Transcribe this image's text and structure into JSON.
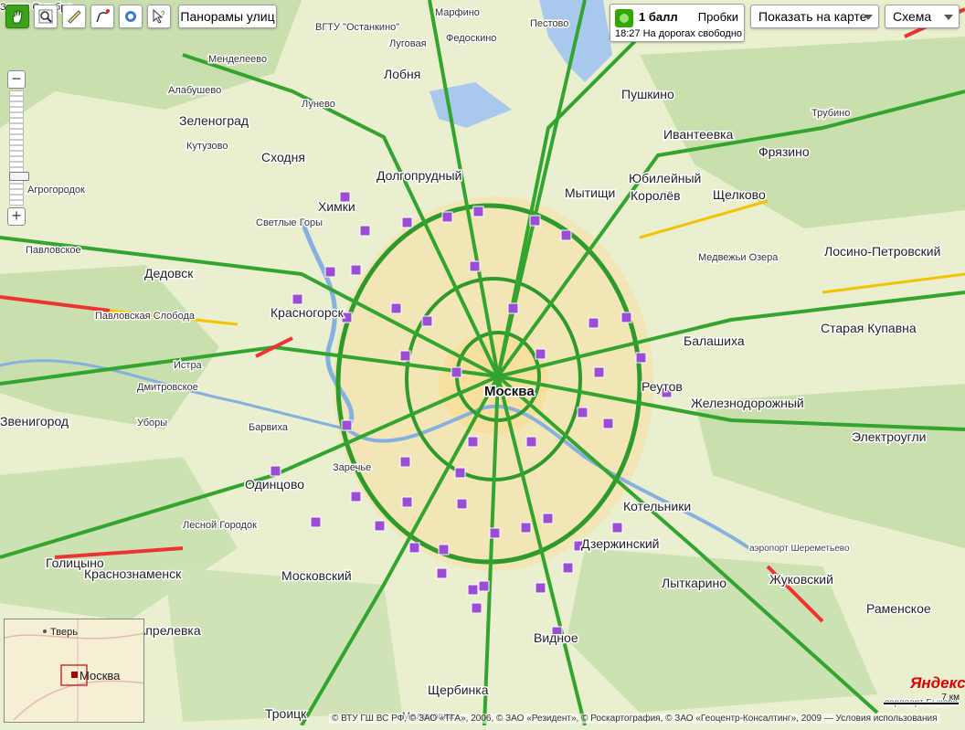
{
  "toolbar": {
    "tools": [
      {
        "name": "hand-tool",
        "icon": "hand-icon",
        "active": true
      },
      {
        "name": "magnifier-tool",
        "icon": "magnifier-icon",
        "active": false
      },
      {
        "name": "ruler-tool",
        "icon": "ruler-icon",
        "active": false
      },
      {
        "name": "route-tool",
        "icon": "route-icon",
        "active": false
      },
      {
        "name": "panorama-tool",
        "icon": "panorama-icon",
        "active": false
      },
      {
        "name": "info-tool",
        "icon": "info-cursor-icon",
        "active": false
      }
    ],
    "panorama_label": "Панорамы улиц"
  },
  "traffic": {
    "score": "1 балл",
    "label": "Пробки",
    "status": "18:27 На дорогах свободно",
    "light_color": "#2fa800"
  },
  "show_on_map": {
    "label": "Показать на карте"
  },
  "layer": {
    "label": "Схема"
  },
  "minimap": {
    "cities": [
      "Тверь",
      "Москва"
    ]
  },
  "brand": {
    "logo": "Яндекс"
  },
  "scale": {
    "label": "7 км"
  },
  "copyright": "© ВТУ ГШ ВС РФ, © ЗАО «ТГА», 2006, © ЗАО «Резидент», © Роскартография, © ЗАО «Геоцентр-Консалтинг», 2009 — Условия использования",
  "places": [
    {
      "name": "Марфино",
      "kind": "town"
    },
    {
      "name": "Пестово",
      "kind": "town"
    },
    {
      "name": "ВГТУ \"Останкино\"",
      "kind": "town"
    },
    {
      "name": "Федоскино",
      "kind": "town"
    },
    {
      "name": "Луговая",
      "kind": "town"
    },
    {
      "name": "Менделеево",
      "kind": "town"
    },
    {
      "name": "Лобня",
      "kind": "city"
    },
    {
      "name": "Алабушево",
      "kind": "town"
    },
    {
      "name": "Зеленоград",
      "kind": "city"
    },
    {
      "name": "Лунево",
      "kind": "town"
    },
    {
      "name": "Сходня",
      "kind": "city"
    },
    {
      "name": "Кутузово",
      "kind": "town"
    },
    {
      "name": "Пушкино",
      "kind": "city"
    },
    {
      "name": "Ивантеевка",
      "kind": "city"
    },
    {
      "name": "Фрязино",
      "kind": "city"
    },
    {
      "name": "Трубино",
      "kind": "town"
    },
    {
      "name": "Долгопрудный",
      "kind": "city"
    },
    {
      "name": "Мытищи",
      "kind": "city"
    },
    {
      "name": "Юбилейный",
      "kind": "city"
    },
    {
      "name": "Королёв",
      "kind": "city"
    },
    {
      "name": "Щелково",
      "kind": "city"
    },
    {
      "name": "Агрогородок",
      "kind": "town"
    },
    {
      "name": "Химки",
      "kind": "city"
    },
    {
      "name": "Светлые Горы",
      "kind": "town"
    },
    {
      "name": "Павловское",
      "kind": "town"
    },
    {
      "name": "Дедовск",
      "kind": "city"
    },
    {
      "name": "Лосино-Петровский",
      "kind": "city"
    },
    {
      "name": "Медвежьи Озера",
      "kind": "town"
    },
    {
      "name": "Балашиха",
      "kind": "city"
    },
    {
      "name": "Старая Купавна",
      "kind": "city"
    },
    {
      "name": "Реутов",
      "kind": "city"
    },
    {
      "name": "Железнодорожный",
      "kind": "city"
    },
    {
      "name": "Электроугли",
      "kind": "city"
    },
    {
      "name": "Красногорск",
      "kind": "city"
    },
    {
      "name": "Павловская Слобода",
      "kind": "town"
    },
    {
      "name": "Истра",
      "kind": "town"
    },
    {
      "name": "Дмитровское",
      "kind": "town"
    },
    {
      "name": "Москва",
      "kind": "capital"
    },
    {
      "name": "Звенигород",
      "kind": "city"
    },
    {
      "name": "Уборы",
      "kind": "town"
    },
    {
      "name": "Барвиха",
      "kind": "town"
    },
    {
      "name": "Одинцово",
      "kind": "city"
    },
    {
      "name": "Заречье",
      "kind": "town"
    },
    {
      "name": "Лесной Городок",
      "kind": "town"
    },
    {
      "name": "Голицыно",
      "kind": "city"
    },
    {
      "name": "Краснознаменск",
      "kind": "city"
    },
    {
      "name": "Московский",
      "kind": "city"
    },
    {
      "name": "Котельники",
      "kind": "city"
    },
    {
      "name": "Лыткарино",
      "kind": "city"
    },
    {
      "name": "Дзержинский",
      "kind": "city"
    },
    {
      "name": "Жуковский",
      "kind": "city"
    },
    {
      "name": "Раменское",
      "kind": "city"
    },
    {
      "name": "Видное",
      "kind": "city"
    },
    {
      "name": "Апрелевка",
      "kind": "city"
    },
    {
      "name": "Щербинка",
      "kind": "city"
    },
    {
      "name": "Троицк",
      "kind": "city"
    },
    {
      "name": "аэропорт Шереметьево",
      "kind": "poi"
    },
    {
      "name": "аэропорт Быково",
      "kind": "poi"
    },
    {
      "name": "Малаховка",
      "kind": "town"
    },
    {
      "name": "Знамя Октября",
      "kind": "town"
    }
  ]
}
